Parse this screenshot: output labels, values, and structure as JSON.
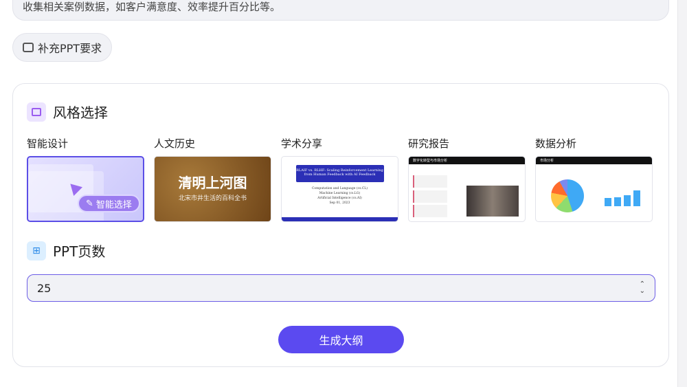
{
  "top_text": "收集相关案例数据，如客户满意度、效率提升百分比等。",
  "supplement_button": "补充PPT要求",
  "style_section": {
    "title": "风格选择",
    "styles": [
      {
        "label": "智能设计",
        "chip": "智能选择",
        "selected": true
      },
      {
        "label": "人文历史",
        "title": "清明上河图",
        "subtitle": "北宋市井生活的百科全书"
      },
      {
        "label": "学术分享",
        "title": "RLAIF vs. RLHF: Scaling Reinforcement Learning from Human Feedback with AI Feedback",
        "lines": [
          "Computation and Language (cs.CL)",
          "Machine Learning (cs.LG)",
          "Artificial Intelligence (cs.AI)",
          "Sep 01, 2023"
        ]
      },
      {
        "label": "研究报告",
        "header": "数字化转型与市场分析"
      },
      {
        "label": "数据分析",
        "header": "市场分析"
      }
    ]
  },
  "pages_section": {
    "title": "PPT页数",
    "value": "25"
  },
  "generate_button": "生成大纲",
  "colors": {
    "accent": "#5b4af0"
  }
}
